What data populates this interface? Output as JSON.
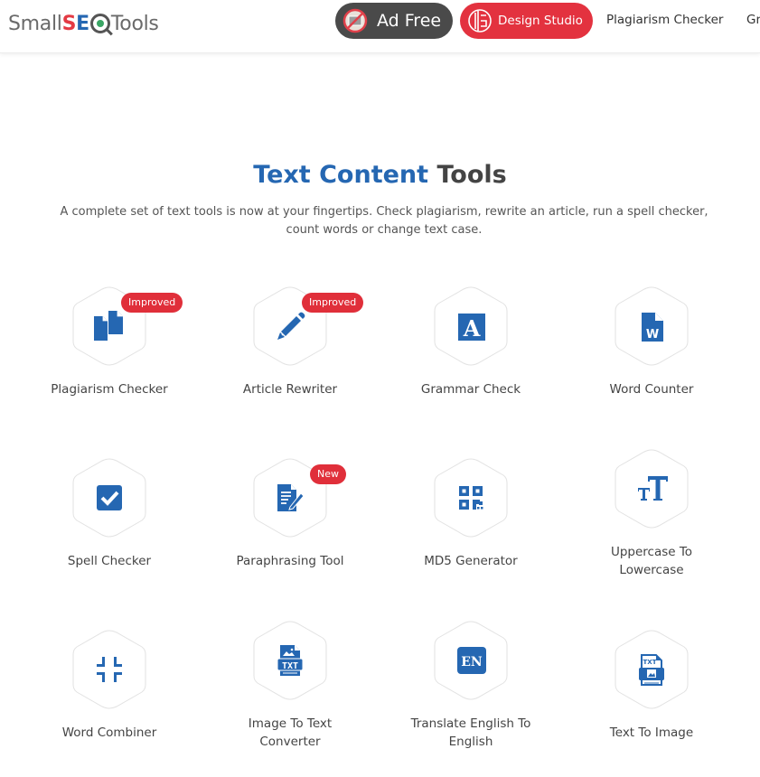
{
  "header": {
    "logo": {
      "small": "Small",
      "s": "S",
      "e": "E",
      "tools": "Tools"
    },
    "ad_free_label": "Ad Free",
    "design_studio_label": "Design Studio",
    "nav": [
      "Plagiarism Checker",
      "Gr"
    ]
  },
  "colors": {
    "brand_blue": "#2567b2",
    "brand_red": "#e3323f",
    "dark_button": "#4a4a4a"
  },
  "section": {
    "title_blue": "Text Content",
    "title_dark": "Tools",
    "description_line1": "A complete set of text tools is now at your fingertips. Check plagiarism, rewrite an article, run a spell checker,",
    "description_line2": "count words or change text case."
  },
  "tools": [
    {
      "label": "Plagiarism Checker",
      "icon": "copy-documents-icon",
      "badge": "Improved"
    },
    {
      "label": "Article Rewriter",
      "icon": "pencil-icon",
      "badge": "Improved"
    },
    {
      "label": "Grammar Check",
      "icon": "letter-a-icon",
      "badge": null
    },
    {
      "label": "Word Counter",
      "icon": "word-document-icon",
      "badge": null
    },
    {
      "label": "Spell Checker",
      "icon": "checkbox-icon",
      "badge": null
    },
    {
      "label": "Paraphrasing Tool",
      "icon": "document-edit-icon",
      "badge": "New"
    },
    {
      "label": "MD5 Generator",
      "icon": "qr-code-icon",
      "badge": null
    },
    {
      "label": "Uppercase To Lowercase",
      "label_line1": "Uppercase To",
      "label_line2": "Lowercase",
      "icon": "text-case-icon",
      "badge": null
    },
    {
      "label": "Word Combiner",
      "icon": "compress-icon",
      "badge": null
    },
    {
      "label": "Image To Text Converter",
      "label_line1": "Image To Text",
      "label_line2": "Converter",
      "icon": "image-txt-icon",
      "badge": null
    },
    {
      "label": "Translate English To English",
      "label_line1": "Translate English To",
      "label_line2": "English",
      "icon": "en-icon",
      "badge": null
    },
    {
      "label": "Text To Image",
      "icon": "txt-image-icon",
      "badge": null
    }
  ],
  "icon_texts": {
    "grammar": "A",
    "word": "W",
    "en": "EN",
    "txt": "TXT"
  }
}
